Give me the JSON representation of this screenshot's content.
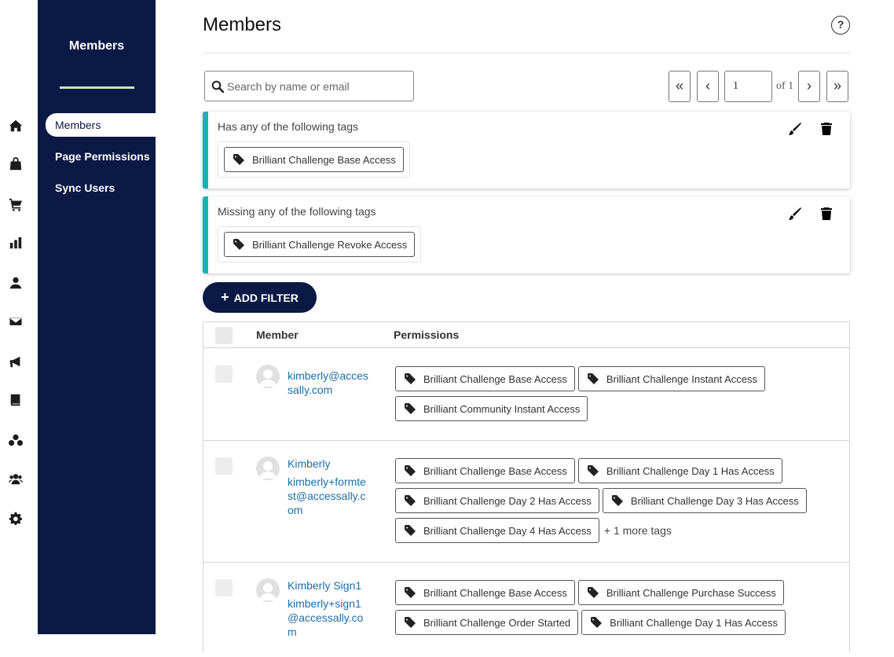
{
  "rail": {
    "icons": [
      "home-icon",
      "store-icon",
      "cart-icon",
      "chart-icon",
      "user-icon",
      "mail-icon",
      "megaphone-icon",
      "book-icon",
      "groups-icon",
      "community-icon",
      "gear-icon"
    ]
  },
  "sidebar": {
    "title": "Members",
    "items": [
      {
        "label": "Members",
        "active": true
      },
      {
        "label": "Page Permissions",
        "active": false
      },
      {
        "label": "Sync Users",
        "active": false
      }
    ]
  },
  "header": {
    "title": "Members",
    "help_label": "?"
  },
  "search": {
    "placeholder": "Search by name or email",
    "value": ""
  },
  "pagination": {
    "first": "«",
    "prev": "‹",
    "current": "1",
    "of_label": "of 1",
    "next": "›",
    "last": "»"
  },
  "filters": [
    {
      "label": "Has any of the following tags",
      "tags": [
        "Brilliant Challenge Base Access"
      ]
    },
    {
      "label": "Missing any of the following tags",
      "tags": [
        "Brilliant Challenge Revoke Access"
      ]
    }
  ],
  "add_filter": {
    "plus": "+",
    "label": "ADD FILTER"
  },
  "table": {
    "headers": {
      "member": "Member",
      "permissions": "Permissions"
    },
    "rows": [
      {
        "name": "",
        "email": "kimberly@accessally.com",
        "tags": [
          "Brilliant Challenge Base Access",
          "Brilliant Challenge Instant Access",
          "Brilliant Community Instant Access"
        ],
        "more": ""
      },
      {
        "name": "Kimberly",
        "email": "kimberly+formtest@accessally.com",
        "tags": [
          "Brilliant Challenge Base Access",
          "Brilliant Challenge Day 1 Has Access",
          "Brilliant Challenge Day 2 Has Access",
          "Brilliant Challenge Day 3 Has Access",
          "Brilliant Challenge Day 4 Has Access"
        ],
        "more": "+ 1 more tags"
      },
      {
        "name": "Kimberly Sign1",
        "email": "kimberly+sign1@accessally.com",
        "tags": [
          "Brilliant Challenge Base Access",
          "Brilliant Challenge Purchase Success",
          "Brilliant Challenge Order Started",
          "Brilliant Challenge Day 1 Has Access"
        ],
        "more": ""
      }
    ]
  },
  "colors": {
    "sidebar_bg": "#0b1a45",
    "accent_teal": "#1bb0b8",
    "link_blue": "#1b6fa8",
    "sidebar_underline": "#c7e4c6"
  }
}
